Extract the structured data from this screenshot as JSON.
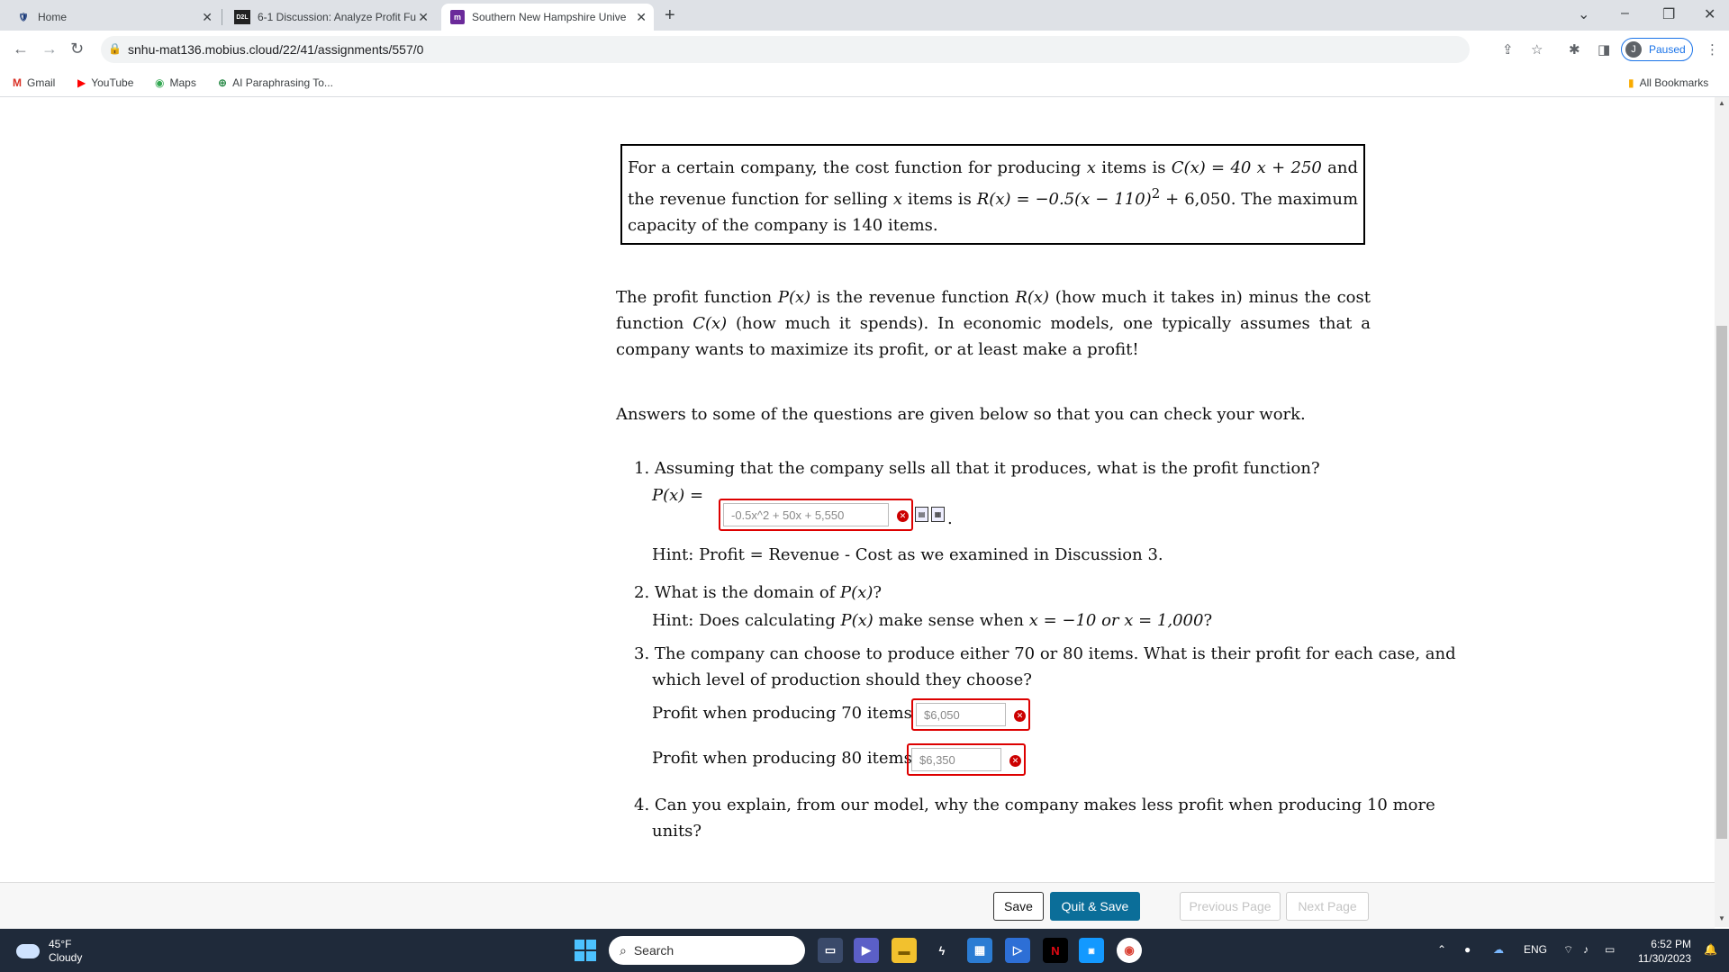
{
  "browser": {
    "tabs": [
      {
        "title": "Home",
        "icon": "shield-icon"
      },
      {
        "title": "6-1 Discussion: Analyze Profit Fu",
        "icon": "d2l-icon"
      },
      {
        "title": "Southern New Hampshire Unive",
        "icon": "mobius-icon"
      }
    ],
    "url": "snhu-mat136.mobius.cloud/22/41/assignments/557/0",
    "profile_initial": "J",
    "profile_status": "Paused",
    "bookmarks": [
      "Gmail",
      "YouTube",
      "Maps",
      "AI Paraphrasing To..."
    ],
    "all_bookmarks": "All Bookmarks"
  },
  "problem": {
    "statement_1": "For a certain company, the cost function for producing ",
    "x": "x",
    "statement_2": " items is ",
    "cost_fn": "C(x) = 40 x + 250",
    "statement_3": " and the revenue function for selling ",
    "statement_4": " items is ",
    "revenue_fn": "R(x) = −0.5(x − 110)",
    "revenue_exp": "2",
    "revenue_tail": " + 6,050",
    "statement_5": ". The maximum capacity of the company is ",
    "capacity": "140",
    "statement_6": " items."
  },
  "intro": {
    "p1_a": "The profit function ",
    "p1_P": "P(x)",
    "p1_b": " is the revenue function ",
    "p1_R": "R(x)",
    "p1_c": " (how much it takes in)  minus the cost function ",
    "p1_C": "C(x)",
    "p1_d": " (how much it spends). In economic models, one typically assumes that a company wants to maximize its profit, or at least make a profit!",
    "p2": "Answers to some of the questions are given below so that you can check your work."
  },
  "questions": {
    "q1": "1. Assuming that the company sells all that it produces, what is the profit function?",
    "q1_label": "P(x) =",
    "q1_answer": "-0.5x^2 + 50x + 5,550",
    "q1_hint": "Hint: Profit = Revenue - Cost as we examined in Discussion 3.",
    "q2_a": "2. What is the domain of ",
    "q2_P": "P(x)",
    "q2_b": "?",
    "q2_hint_a": "Hint: Does calculating ",
    "q2_hint_P": "P(x)",
    "q2_hint_b": " make sense when ",
    "q2_hint_vals": "x = −10 or x = 1,000",
    "q2_hint_c": "?",
    "q3_line1": "3. The company can choose to produce either 70 or 80 items. What is their profit for each case, and",
    "q3_line2": "which level of production should they choose?",
    "q3_70_label": "Profit when producing 70 items =",
    "q3_70_answer": "$6,050",
    "q3_80_label": "Profit when producing 80 items =",
    "q3_80_answer": "$6,350",
    "q4_line1": "4. Can you explain, from our model, why the company makes less profit when producing 10 more",
    "q4_line2": "units?"
  },
  "actions": {
    "save": "Save",
    "quit_save": "Quit & Save",
    "previous": "Previous Page",
    "next": "Next Page"
  },
  "taskbar": {
    "temp": "45°F",
    "condition": "Cloudy",
    "search": "Search",
    "lang": "ENG",
    "time": "6:52 PM",
    "date": "11/30/2023"
  },
  "colors": {
    "error_red": "#d00000",
    "quit_button": "#0b6e99",
    "taskbar": "#1f2a3a"
  }
}
